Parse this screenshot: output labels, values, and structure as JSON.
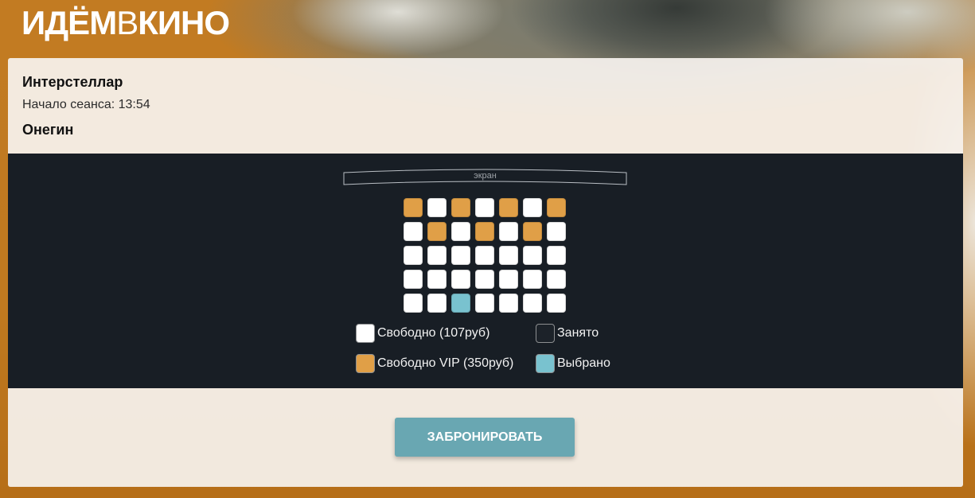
{
  "logo": {
    "part1": "ИДЁМ",
    "part2": "В",
    "part3": "КИНО"
  },
  "session": {
    "movie_title": "Интерстеллар",
    "start_label": "Начало сеанса:",
    "start_time": "13:54",
    "hall_name": "Онегин"
  },
  "hall": {
    "screen_label": "экран",
    "seat_rows": [
      [
        2,
        0,
        2,
        0,
        2,
        0,
        2
      ],
      [
        0,
        2,
        0,
        2,
        0,
        2,
        0
      ],
      [
        0,
        0,
        0,
        0,
        0,
        0,
        0
      ],
      [
        0,
        0,
        0,
        0,
        0,
        0,
        0
      ],
      [
        0,
        0,
        3,
        0,
        0,
        0,
        0
      ]
    ]
  },
  "legend": [
    {
      "label": "Свободно (107руб)",
      "color": "#ffffff"
    },
    {
      "label": "Занято",
      "color": "#1c2229"
    },
    {
      "label": "Свободно VIP (350руб)",
      "color": "#e09f47"
    },
    {
      "label": "Выбрано",
      "color": "#79c2cf"
    }
  ],
  "book_button": {
    "label": "ЗАБРОНИРОВАТЬ"
  },
  "colors": {
    "hall_background": "#181e25",
    "book_button": "#69a7b2"
  }
}
